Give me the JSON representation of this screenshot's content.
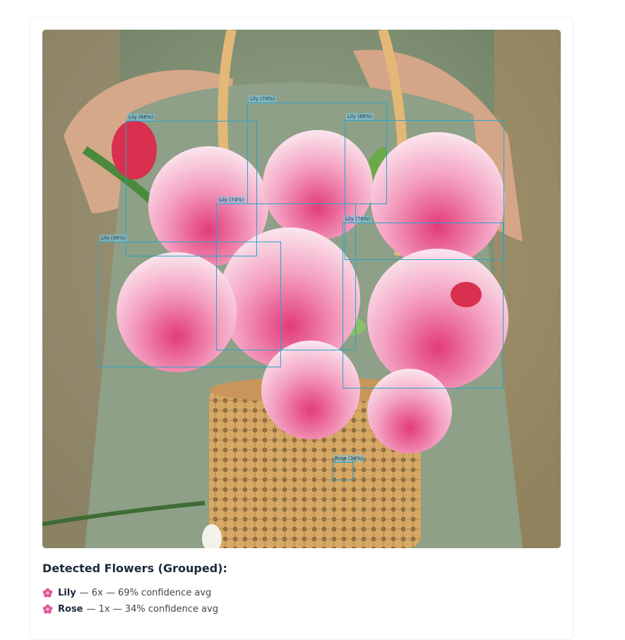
{
  "detections": [
    {
      "label": "Lily (68%)"
    },
    {
      "label": "Lily (74%)"
    },
    {
      "label": "Lily (86%)"
    },
    {
      "label": "Lily (74%)"
    },
    {
      "label": "Lily (76%)"
    },
    {
      "label": "Lily (36%)"
    },
    {
      "label": "Rose (34%)"
    }
  ],
  "results": {
    "title": "Detected Flowers (Grouped):",
    "items": [
      {
        "name": "Lily",
        "detail": "— 6x — 69% confidence avg"
      },
      {
        "name": "Rose",
        "detail": "— 1x — 34% confidence avg"
      }
    ]
  },
  "colors": {
    "bbox": "#2aa4c9",
    "flower_icon": "#e2559a",
    "title": "#1e2a3a"
  }
}
